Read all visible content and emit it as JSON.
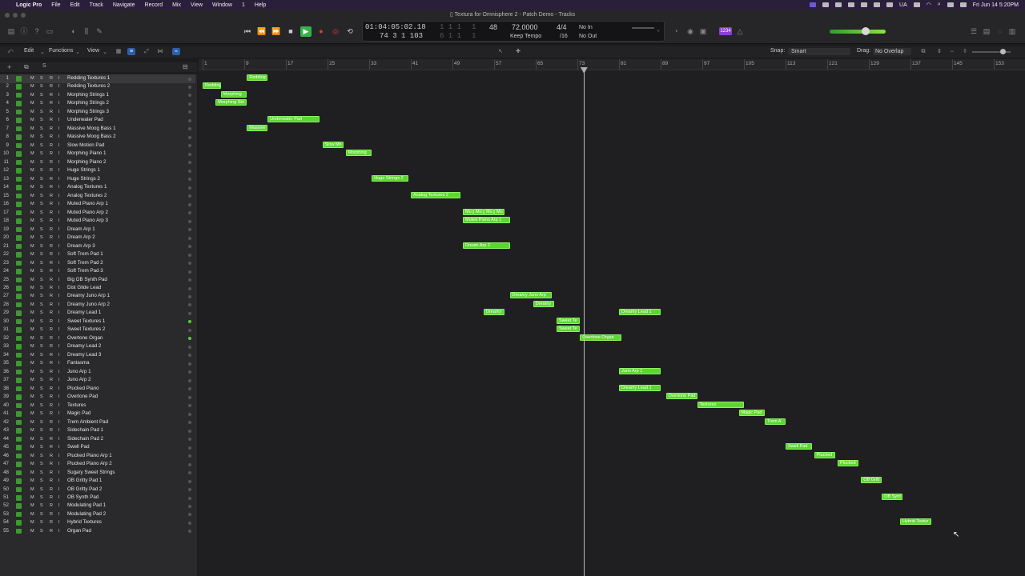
{
  "menubar": {
    "app": "Logic Pro",
    "items": [
      "File",
      "Edit",
      "Track",
      "Navigate",
      "Record",
      "Mix",
      "View",
      "Window",
      "1",
      "Help"
    ],
    "status": {
      "locale": "UA",
      "datetime": "Fri Jun 14  5:20PM"
    }
  },
  "window": {
    "title": "Textura for Omnisphere 2 - Patch Demo - Tracks"
  },
  "lcd": {
    "time": "01:04:05:02.18",
    "bars": "74  3  1  103",
    "dim_top": "1  1  1",
    "dim_bottom": "6  1  1",
    "dim_top2": "1",
    "dim_bottom2": "1",
    "bpm_top": "48",
    "tempo": "72.0000",
    "tempo_mode": "Keep Tempo",
    "signature": "4/4",
    "division": "/16",
    "in": "No In",
    "out": "No Out",
    "badge": "1234"
  },
  "toolbar": {
    "edit": "Edit",
    "functions": "Functions",
    "view": "View",
    "snap_label": "Snap:",
    "snap_value": "Smart",
    "drag_label": "Drag:",
    "drag_value": "No Overlap"
  },
  "ruler": {
    "marks": [
      "1",
      "9",
      "17",
      "25",
      "33",
      "41",
      "49",
      "57",
      "65",
      "73",
      "81",
      "89",
      "97",
      "105",
      "113",
      "121",
      "129",
      "137",
      "145",
      "153"
    ]
  },
  "tracks": [
    {
      "n": "1",
      "name": "Redding Textures 1",
      "dot": "off"
    },
    {
      "n": "2",
      "name": "Redding Textures 2",
      "dot": "off"
    },
    {
      "n": "3",
      "name": "Morphing Strings 1",
      "dot": "off"
    },
    {
      "n": "4",
      "name": "Morphing Strings 2",
      "dot": "off"
    },
    {
      "n": "5",
      "name": "Morphing Strings 3",
      "dot": "off"
    },
    {
      "n": "6",
      "name": "Underwater Pad",
      "dot": "off"
    },
    {
      "n": "7",
      "name": "Massive Moog Bass 1",
      "dot": "off"
    },
    {
      "n": "8",
      "name": "Massive Moog Bass 2",
      "dot": "off"
    },
    {
      "n": "9",
      "name": "Slow Motion Pad",
      "dot": "off"
    },
    {
      "n": "10",
      "name": "Morphing Piano 1",
      "dot": "off"
    },
    {
      "n": "11",
      "name": "Morphing Piano 2",
      "dot": "off"
    },
    {
      "n": "12",
      "name": "Huge Strings 1",
      "dot": "off"
    },
    {
      "n": "13",
      "name": "Huge Strings 2",
      "dot": "off"
    },
    {
      "n": "14",
      "name": "Analog Textures 1",
      "dot": "off"
    },
    {
      "n": "15",
      "name": "Analog Textures 2",
      "dot": "off"
    },
    {
      "n": "16",
      "name": "Muted Piano Arp 1",
      "dot": "off"
    },
    {
      "n": "17",
      "name": "Muted Piano Arp 2",
      "dot": "off"
    },
    {
      "n": "18",
      "name": "Muted Piano Arp 3",
      "dot": "off"
    },
    {
      "n": "19",
      "name": "Dream Arp 1",
      "dot": "off"
    },
    {
      "n": "20",
      "name": "Dream Arp 2",
      "dot": "off"
    },
    {
      "n": "21",
      "name": "Dream Arp 3",
      "dot": "off"
    },
    {
      "n": "22",
      "name": "Soft Trem Pad 1",
      "dot": "off"
    },
    {
      "n": "23",
      "name": "Soft Trem Pad 2",
      "dot": "off"
    },
    {
      "n": "24",
      "name": "Soft Trem Pad 3",
      "dot": "off"
    },
    {
      "n": "25",
      "name": "Big OB Synth Pad",
      "dot": "off"
    },
    {
      "n": "26",
      "name": "Dist Glide Lead",
      "dot": "off"
    },
    {
      "n": "27",
      "name": "Dreamy Juno Arp 1",
      "dot": "off"
    },
    {
      "n": "28",
      "name": "Dreamy Juno Arp 2",
      "dot": "off"
    },
    {
      "n": "29",
      "name": "Dreamy Lead 1",
      "dot": "off"
    },
    {
      "n": "30",
      "name": "Sweet Textures 1",
      "dot": "on"
    },
    {
      "n": "31",
      "name": "Sweet Textures 2",
      "dot": "off"
    },
    {
      "n": "32",
      "name": "Overtone Organ",
      "dot": "on"
    },
    {
      "n": "33",
      "name": "Dreamy Lead 2",
      "dot": "off"
    },
    {
      "n": "34",
      "name": "Dreamy Lead 3",
      "dot": "off"
    },
    {
      "n": "35",
      "name": "Fantasma",
      "dot": "off"
    },
    {
      "n": "36",
      "name": "Juno Arp 1",
      "dot": "off"
    },
    {
      "n": "37",
      "name": "Juno Arp 2",
      "dot": "off"
    },
    {
      "n": "38",
      "name": "Plucked Piano",
      "dot": "off"
    },
    {
      "n": "39",
      "name": "Overtone Pad",
      "dot": "off"
    },
    {
      "n": "40",
      "name": "Textures",
      "dot": "off"
    },
    {
      "n": "41",
      "name": "Magic Pad",
      "dot": "off"
    },
    {
      "n": "42",
      "name": "Trem Ambient Pad",
      "dot": "off"
    },
    {
      "n": "43",
      "name": "Sidechain Pad 1",
      "dot": "off"
    },
    {
      "n": "44",
      "name": "Sidechain Pad 2",
      "dot": "off"
    },
    {
      "n": "45",
      "name": "Swell Pad",
      "dot": "off"
    },
    {
      "n": "46",
      "name": "Plucked Piano Arp 1",
      "dot": "off"
    },
    {
      "n": "47",
      "name": "Plucked Piano Arp 2",
      "dot": "off"
    },
    {
      "n": "48",
      "name": "Sugary Sweet Strings",
      "dot": "off"
    },
    {
      "n": "49",
      "name": "OB Gritty Pad 1",
      "dot": "off"
    },
    {
      "n": "50",
      "name": "OB Gritty Pad 2",
      "dot": "off"
    },
    {
      "n": "51",
      "name": "OB Synth Pad",
      "dot": "off"
    },
    {
      "n": "52",
      "name": "Modulating Pad 1",
      "dot": "off"
    },
    {
      "n": "53",
      "name": "Modulating Pad 2",
      "dot": "off"
    },
    {
      "n": "54",
      "name": "Hybrid Textures",
      "dot": "off"
    },
    {
      "n": "55",
      "name": "Organ Pad",
      "dot": "off"
    }
  ],
  "regions": [
    {
      "track": 1,
      "start": 9.5,
      "end": 13.5,
      "label": "Redding"
    },
    {
      "track": 2,
      "start": 1,
      "end": 4.5,
      "label": "Redding"
    },
    {
      "track": 3,
      "start": 4.5,
      "end": 9.5,
      "label": "Morphing"
    },
    {
      "track": 4,
      "start": 3.5,
      "end": 9.5,
      "label": "Morphing Stri"
    },
    {
      "track": 6,
      "start": 13.5,
      "end": 23.5,
      "label": "Underwater Pad"
    },
    {
      "track": 7,
      "start": 9.5,
      "end": 13.5,
      "label": "Massive"
    },
    {
      "track": 9,
      "start": 24,
      "end": 28,
      "label": "Slow Mo"
    },
    {
      "track": 10,
      "start": 28.5,
      "end": 33.5,
      "label": "Morphing"
    },
    {
      "track": 13,
      "start": 33.5,
      "end": 40.5,
      "label": "Huge Strings 2"
    },
    {
      "track": 15,
      "start": 41,
      "end": 50.5,
      "label": "Analog Textures 2"
    },
    {
      "track": 17,
      "start": 51,
      "end": 53,
      "label": "Mu"
    },
    {
      "track": 17,
      "start": 53,
      "end": 55,
      "label": "Mu"
    },
    {
      "track": 17,
      "start": 55,
      "end": 57,
      "label": "Mu"
    },
    {
      "track": 17,
      "start": 57,
      "end": 59,
      "label": "Mu"
    },
    {
      "track": 18,
      "start": 51,
      "end": 60,
      "label": "Muted Piano Arp 1"
    },
    {
      "track": 21,
      "start": 51,
      "end": 60,
      "label": "Dream Arp 2"
    },
    {
      "track": 27,
      "start": 60,
      "end": 68,
      "label": "Dreamy Juno Arp"
    },
    {
      "track": 28,
      "start": 64.5,
      "end": 68.5,
      "label": "Dreamy"
    },
    {
      "track": 29,
      "start": 55,
      "end": 59,
      "label": "Dreamy"
    },
    {
      "track": 29,
      "start": 81,
      "end": 89,
      "label": "Dreamy Lead 1"
    },
    {
      "track": 30,
      "start": 69,
      "end": 73.5,
      "label": "Sweet Te"
    },
    {
      "track": 31,
      "start": 69,
      "end": 73.5,
      "label": "Sweet Te"
    },
    {
      "track": 32,
      "start": 73.5,
      "end": 81.5,
      "label": "Overtone Organ"
    },
    {
      "track": 36,
      "start": 81,
      "end": 89,
      "label": "Juno Arp 1"
    },
    {
      "track": 38,
      "start": 81,
      "end": 89,
      "label": "Dreamy Lead 1"
    },
    {
      "track": 39,
      "start": 90,
      "end": 96,
      "label": "Overtone Pad"
    },
    {
      "track": 40,
      "start": 96,
      "end": 105,
      "label": "Textures"
    },
    {
      "track": 41,
      "start": 104,
      "end": 109,
      "label": "Magic Pad"
    },
    {
      "track": 42,
      "start": 109,
      "end": 113,
      "label": "Trem A"
    },
    {
      "track": 45,
      "start": 113,
      "end": 118,
      "label": "Swell Pad"
    },
    {
      "track": 46,
      "start": 118.5,
      "end": 122.5,
      "label": "Plucked"
    },
    {
      "track": 47,
      "start": 123,
      "end": 127,
      "label": "Plucked"
    },
    {
      "track": 49,
      "start": 127.5,
      "end": 131.5,
      "label": "OB Gritt"
    },
    {
      "track": 51,
      "start": 131.5,
      "end": 135.5,
      "label": "OB Synt"
    },
    {
      "track": 54,
      "start": 135,
      "end": 141,
      "label": "Hybrid Textur"
    }
  ],
  "playhead": {
    "bar": 74.2
  }
}
